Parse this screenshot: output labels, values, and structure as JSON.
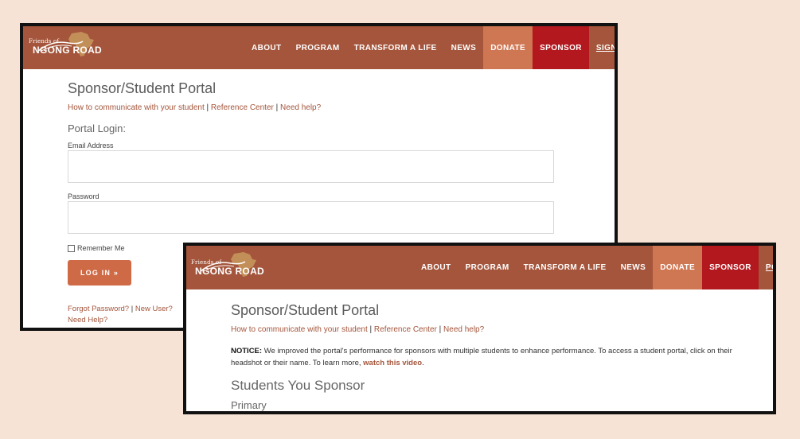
{
  "brand": {
    "logo_small": "Friends of",
    "logo_big": "NGONG ROAD"
  },
  "login_screen": {
    "nav": {
      "about": "ABOUT",
      "program": "PROGRAM",
      "transform": "TRANSFORM A LIFE",
      "news": "NEWS",
      "donate": "DONATE",
      "sponsor": "SPONSOR",
      "sign_in": "SIGN IN"
    },
    "title": "Sponsor/Student Portal",
    "help_links": {
      "communicate": "How to communicate with your student",
      "separator": "|",
      "reference": "Reference Center",
      "need_help": "Need help?"
    },
    "portal_login_heading": "Portal Login:",
    "email_label": "Email Address",
    "email_value": "",
    "password_label": "Password",
    "password_value": "",
    "remember_label": "Remember Me",
    "login_button": "LOG IN »",
    "forgot_password": "Forgot Password?",
    "footer_separator": "|",
    "new_user": "New User?",
    "need_help_footer": "Need Help?"
  },
  "portal_screen": {
    "nav": {
      "about": "ABOUT",
      "program": "PROGRAM",
      "transform": "TRANSFORM A LIFE",
      "news": "NEWS",
      "donate": "DONATE",
      "sponsor": "SPONSOR",
      "portal": "PORTAL"
    },
    "title": "Sponsor/Student Portal",
    "help_links": {
      "communicate": "How to communicate with your student",
      "separator": "|",
      "reference": "Reference Center",
      "need_help": "Need help?"
    },
    "notice_label": "NOTICE:",
    "notice_text": "We improved the portal's performance for sponsors with multiple students to enhance performance. To access a student portal, click on their headshot or their name. To learn more,",
    "notice_link": "watch this video",
    "notice_end": ".",
    "students_heading": "Students You Sponsor",
    "primary_heading": "Primary"
  },
  "colors": {
    "background": "#f6e3d6",
    "nav": "#a4553b",
    "donate": "#cf7653",
    "sponsor": "#b2181e",
    "link": "#a4553b",
    "button": "#cf6a47"
  }
}
